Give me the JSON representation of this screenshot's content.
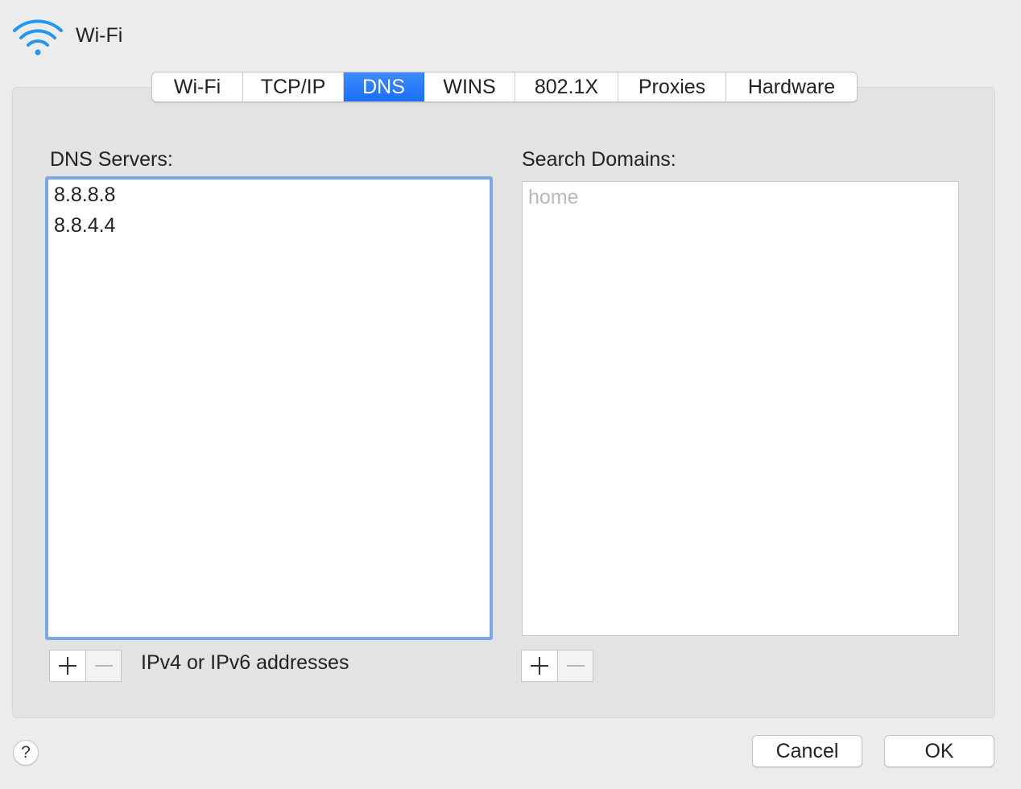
{
  "header": {
    "icon": "wifi-icon",
    "title": "Wi-Fi",
    "accent": "#2196f3"
  },
  "tabs": [
    {
      "label": "Wi-Fi",
      "active": false
    },
    {
      "label": "TCP/IP",
      "active": false
    },
    {
      "label": "DNS",
      "active": true
    },
    {
      "label": "WINS",
      "active": false
    },
    {
      "label": "802.1X",
      "active": false
    },
    {
      "label": "Proxies",
      "active": false
    },
    {
      "label": "Hardware",
      "active": false
    }
  ],
  "dns": {
    "label": "DNS Servers:",
    "servers": [
      "8.8.8.8",
      "8.8.4.4"
    ],
    "hint": "IPv4 or IPv6 addresses",
    "add_icon": "plus-icon",
    "remove_icon": "minus-icon"
  },
  "search": {
    "label": "Search Domains:",
    "placeholder": "home",
    "add_icon": "plus-icon",
    "remove_icon": "minus-icon"
  },
  "footer": {
    "help": "?",
    "cancel": "Cancel",
    "ok": "OK"
  },
  "colors": {
    "active_tab": "#1a6ff5",
    "focus_ring": "#7ba7e6",
    "background": "#ececec",
    "panel": "#e3e3e3"
  }
}
